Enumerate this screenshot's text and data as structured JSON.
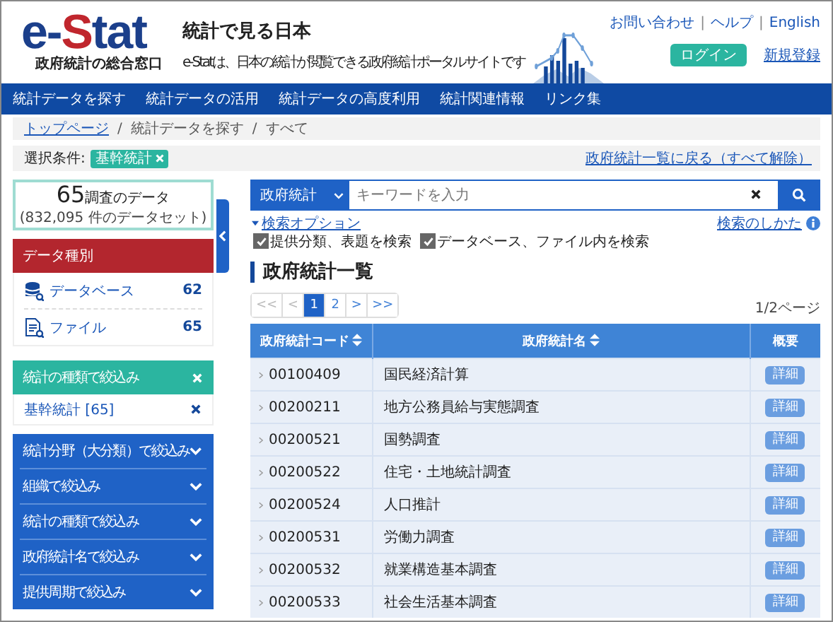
{
  "header": {
    "logo": {
      "prefix": "e-",
      "highlight": "S",
      "suffix": "tat",
      "subtitle": "政府統計の総合窓口"
    },
    "title": "統計で見る日本",
    "tagline": "e-Statは、日本の統計が閲覧できる政府統計ポータルサイトです",
    "links": [
      "お問い合わせ",
      "ヘルプ",
      "English"
    ],
    "link_separator": "|",
    "login": "ログイン",
    "register": "新規登録"
  },
  "nav": [
    "統計データを探す",
    "統計データの活用",
    "統計データの高度利用",
    "統計関連情報",
    "リンク集"
  ],
  "breadcrumb_separator": "/",
  "breadcrumb": [
    {
      "label": "トップページ",
      "link": true
    },
    {
      "label": "統計データを探す",
      "link": false
    },
    {
      "label": "すべて",
      "link": false
    }
  ],
  "selection": {
    "label": "選択条件:",
    "tags": [
      "基幹統計"
    ],
    "reset_link": "政府統計一覧に戻る（すべて解除）"
  },
  "summary": {
    "count": "65",
    "count_label": "調査のデータ",
    "detail": "(832,095 件のデータセット)"
  },
  "data_kind": {
    "title": "データ種別",
    "items": [
      {
        "kind": "database",
        "label": "データベース",
        "count": "62"
      },
      {
        "kind": "file",
        "label": "ファイル",
        "count": "65"
      }
    ]
  },
  "active_filter": {
    "title": "統計の種類で絞込み",
    "items": [
      {
        "label": "基幹統計 [65]"
      }
    ]
  },
  "filters": [
    {
      "label": "統計分野（大分類）で絞込み",
      "expanded": false
    },
    {
      "label": "組織で絞込み",
      "expanded": false
    },
    {
      "label": "統計の種類で絞込み",
      "expanded": false
    },
    {
      "label": "政府統計名で絞込み",
      "expanded": false
    },
    {
      "label": "提供周期で絞込み",
      "expanded": false
    }
  ],
  "search": {
    "scope": "政府統計",
    "placeholder": "キーワードを入力",
    "options_link": "検索オプション",
    "help_link": "検索のしかた",
    "options": [
      {
        "label": "提供分類、表題を検索",
        "checked": true
      },
      {
        "label": "データベース、ファイル内を検索",
        "checked": true
      }
    ]
  },
  "list": {
    "title": "政府統計一覧",
    "pages": [
      {
        "label": "<<",
        "selected": false,
        "disabled": true
      },
      {
        "label": "<",
        "selected": false,
        "disabled": true
      },
      {
        "label": "1",
        "selected": true,
        "disabled": false
      },
      {
        "label": "2",
        "selected": false,
        "disabled": false
      },
      {
        "label": ">",
        "selected": false,
        "disabled": false
      },
      {
        "label": ">>",
        "selected": false,
        "disabled": false
      }
    ],
    "page_info": "1/2ページ",
    "columns": [
      {
        "label": "政府統計コード",
        "sortable": true
      },
      {
        "label": "政府統計名",
        "sortable": true
      },
      {
        "label": "概要",
        "sortable": false
      }
    ],
    "rows": [
      {
        "code": "00100409",
        "name": "国民経済計算",
        "action": "詳細"
      },
      {
        "code": "00200211",
        "name": "地方公務員給与実態調査",
        "action": "詳細"
      },
      {
        "code": "00200521",
        "name": "国勢調査",
        "action": "詳細"
      },
      {
        "code": "00200522",
        "name": "住宅・土地統計調査",
        "action": "詳細"
      },
      {
        "code": "00200524",
        "name": "人口推計",
        "action": "詳細"
      },
      {
        "code": "00200531",
        "name": "労働力調査",
        "action": "詳細"
      },
      {
        "code": "00200532",
        "name": "就業構造基本調査",
        "action": "詳細"
      },
      {
        "code": "00200533",
        "name": "社会生活基本調査",
        "action": "詳細"
      }
    ]
  }
}
